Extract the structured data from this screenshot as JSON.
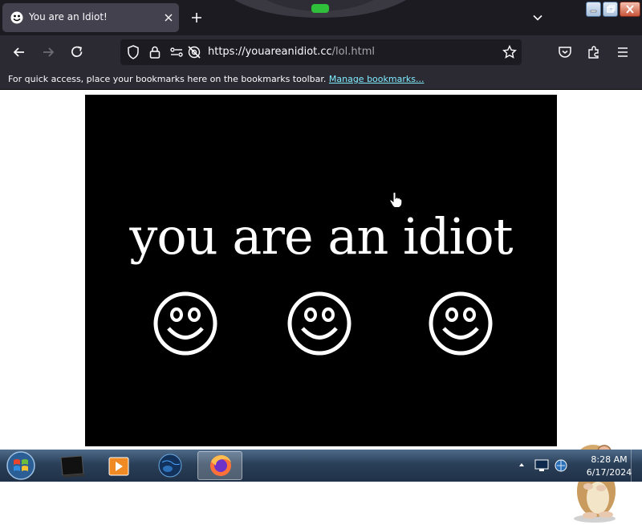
{
  "tab": {
    "title": "You are an Idiot!"
  },
  "address_bar": {
    "url_domain": "https://youareanidiot.cc",
    "url_path": "/lol.html"
  },
  "bookmarks_bar": {
    "message": "For quick access, place your bookmarks here on the bookmarks toolbar.",
    "link": "Manage bookmarks..."
  },
  "page": {
    "headline": "you are an idiot",
    "smiley_count": 3
  },
  "taskbar": {
    "time": "8:28 AM",
    "date": "6/17/2024"
  },
  "colors": {
    "chrome_dark": "#1c1b22",
    "toolbar": "#2b2a33",
    "link": "#80ebff",
    "stage": "#000000"
  },
  "icons": [
    "smiley-favicon",
    "close-icon",
    "plus-icon",
    "chevron-down-icon",
    "back-arrow-icon",
    "forward-arrow-icon",
    "reload-icon",
    "shield-icon",
    "lock-icon",
    "permissions-icon",
    "camera-blocked-icon",
    "star-icon",
    "pocket-icon",
    "extensions-icon",
    "menu-icon",
    "windows-start-icon",
    "firefox-icon"
  ]
}
